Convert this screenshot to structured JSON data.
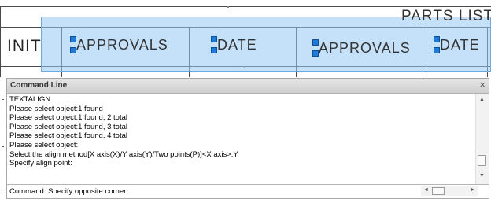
{
  "drawing": {
    "title": "PARTS LIST",
    "row_labels": {
      "init": "INIT",
      "approvals_1": "APPROVALS",
      "date_1": "DATE",
      "approvals_2": "APPROVALS",
      "date_2": "DATE"
    }
  },
  "command_line": {
    "title": "Command Line",
    "close_glyph": "×",
    "history": [
      "TEXTALIGN",
      "Please select object:1 found",
      "Please select object:1 found, 2 total",
      "Please select object:1 found, 3 total",
      "Please select object:1 found, 4 total",
      "Please select object:",
      "Select the align method[X axis(X)/Y axis(Y)/Two points(P)]<X axis>:Y",
      "Specify align point:"
    ],
    "current_input": "Command: Specify opposite corner:"
  },
  "icons": {
    "scroll_up": "▲",
    "scroll_down": "▼",
    "scroll_left": "◄",
    "scroll_right": "►"
  },
  "colors": {
    "selection_fill": "#96c8f5",
    "grip": "#1e7ad6"
  }
}
